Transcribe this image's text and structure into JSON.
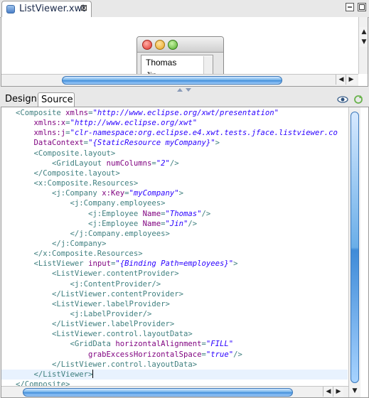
{
  "editor_tab": {
    "title": "ListViewer.xwt",
    "close": "⊠"
  },
  "preview": {
    "list_items": [
      "Thomas",
      "Jin"
    ]
  },
  "view_tabs": {
    "design": "Design",
    "source": "Source"
  },
  "code": {
    "lines": [
      [
        {
          "c": "t",
          "s": "<Composite "
        },
        {
          "c": "a",
          "s": "xmlns"
        },
        {
          "c": "t",
          "s": "="
        },
        {
          "c": "v",
          "s": "\"http://www.eclipse.org/xwt/presentation\""
        }
      ],
      [
        {
          "c": "a",
          "s": "    xmlns:x"
        },
        {
          "c": "t",
          "s": "="
        },
        {
          "c": "v",
          "s": "\"http://www.eclipse.org/xwt\""
        }
      ],
      [
        {
          "c": "a",
          "s": "    xmlns:j"
        },
        {
          "c": "t",
          "s": "="
        },
        {
          "c": "v",
          "s": "\"clr-namespace:org.eclipse.e4.xwt.tests.jface.listviewer.co"
        }
      ],
      [
        {
          "c": "a",
          "s": "    DataContext"
        },
        {
          "c": "t",
          "s": "="
        },
        {
          "c": "v",
          "s": "\"{StaticResource myCompany}\""
        },
        {
          "c": "t",
          "s": ">"
        }
      ],
      [
        {
          "c": "t",
          "s": "    <Composite.layout>"
        }
      ],
      [
        {
          "c": "t",
          "s": "        <GridLayout "
        },
        {
          "c": "a",
          "s": "numColumns"
        },
        {
          "c": "t",
          "s": "="
        },
        {
          "c": "v",
          "s": "\"2\""
        },
        {
          "c": "t",
          "s": "/>"
        }
      ],
      [
        {
          "c": "t",
          "s": "    </Composite.layout>"
        }
      ],
      [
        {
          "c": "t",
          "s": "    <x:Composite.Resources>"
        }
      ],
      [
        {
          "c": "t",
          "s": "        <j:Company "
        },
        {
          "c": "a",
          "s": "x:Key"
        },
        {
          "c": "t",
          "s": "="
        },
        {
          "c": "v",
          "s": "\"myCompany\""
        },
        {
          "c": "t",
          "s": ">"
        }
      ],
      [
        {
          "c": "t",
          "s": "            <j:Company.employees>"
        }
      ],
      [
        {
          "c": "t",
          "s": "                <j:Employee "
        },
        {
          "c": "a",
          "s": "Name"
        },
        {
          "c": "t",
          "s": "="
        },
        {
          "c": "v",
          "s": "\"Thomas\""
        },
        {
          "c": "t",
          "s": "/>"
        }
      ],
      [
        {
          "c": "t",
          "s": "                <j:Employee "
        },
        {
          "c": "a",
          "s": "Name"
        },
        {
          "c": "t",
          "s": "="
        },
        {
          "c": "v",
          "s": "\"Jin\""
        },
        {
          "c": "t",
          "s": "/>"
        }
      ],
      [
        {
          "c": "t",
          "s": "            </j:Company.employees>"
        }
      ],
      [
        {
          "c": "t",
          "s": "        </j:Company>"
        }
      ],
      [
        {
          "c": "t",
          "s": "    </x:Composite.Resources>"
        }
      ],
      [
        {
          "c": "t",
          "s": "    <ListViewer "
        },
        {
          "c": "a",
          "s": "input"
        },
        {
          "c": "t",
          "s": "="
        },
        {
          "c": "v",
          "s": "\"{Binding Path=employees}\""
        },
        {
          "c": "t",
          "s": ">"
        }
      ],
      [
        {
          "c": "t",
          "s": "        <ListViewer.contentProvider>"
        }
      ],
      [
        {
          "c": "t",
          "s": "            <j:ContentProvider/>"
        }
      ],
      [
        {
          "c": "t",
          "s": "        </ListViewer.contentProvider>"
        }
      ],
      [
        {
          "c": "t",
          "s": "        <ListViewer.labelProvider>"
        }
      ],
      [
        {
          "c": "t",
          "s": "            <j:LabelProvider/>"
        }
      ],
      [
        {
          "c": "t",
          "s": "        </ListViewer.labelProvider>"
        }
      ],
      [
        {
          "c": "t",
          "s": "        <ListViewer.control.layoutData>"
        }
      ],
      [
        {
          "c": "t",
          "s": "            <GridData "
        },
        {
          "c": "a",
          "s": "horizontalAlignment"
        },
        {
          "c": "t",
          "s": "="
        },
        {
          "c": "v",
          "s": "\"FILL\""
        }
      ],
      [
        {
          "c": "a",
          "s": "                grabExcessHorizontalSpace"
        },
        {
          "c": "t",
          "s": "="
        },
        {
          "c": "v",
          "s": "\"true\""
        },
        {
          "c": "t",
          "s": "/>"
        }
      ],
      [
        {
          "c": "t",
          "s": "        </ListViewer.control.layoutData>"
        }
      ],
      [
        {
          "c": "t",
          "s": "    </ListViewer>"
        }
      ],
      [
        {
          "c": "t",
          "s": "</Composite>"
        }
      ]
    ],
    "current_line": 26
  }
}
